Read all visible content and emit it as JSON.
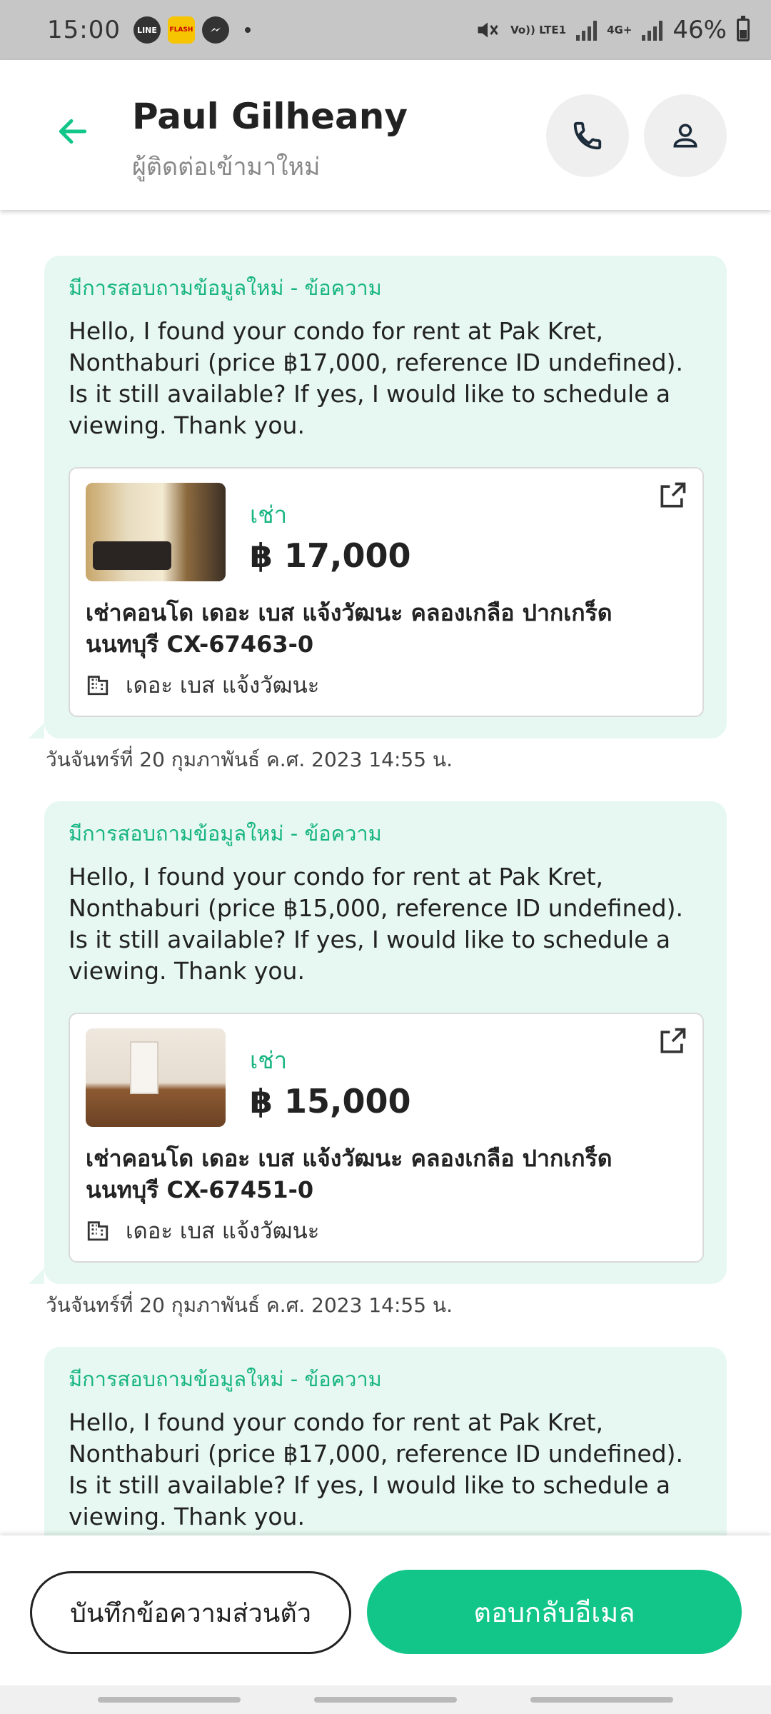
{
  "status_bar": {
    "time": "15:00",
    "notifications": [
      "LINE",
      "FLASH",
      "messenger"
    ],
    "network_1": "Vo)) LTE1",
    "network_2": "4G+",
    "battery": "46%"
  },
  "header": {
    "name": "Paul Gilheany",
    "subtitle": "ผู้ติดต่อเข้ามาใหม่"
  },
  "messages": [
    {
      "title": "มีการสอบถามข้อมูลใหม่ - ข้อความ",
      "text": "Hello, I found your condo for rent at Pak Kret, Nonthaburi (price ฿17,000, reference ID undefined). Is it still available? If yes, I would like to schedule a viewing. Thank you.",
      "listing": {
        "type": "เช่า",
        "price": "฿ 17,000",
        "title": "เช่าคอนโด  เดอะ เบส แจ้งวัฒนะ คลองเกลือ ปากเกร็ด นนทบุรี CX-67463-0",
        "project": "เดอะ เบส แจ้งวัฒนะ"
      },
      "timestamp": "วันจันทร์ที่ 20 กุมภาพันธ์ ค.ศ. 2023 14:55 น."
    },
    {
      "title": "มีการสอบถามข้อมูลใหม่ - ข้อความ",
      "text": "Hello, I found your condo for rent at Pak Kret, Nonthaburi (price ฿15,000, reference ID undefined). Is it still available? If yes, I would like to schedule a viewing. Thank you.",
      "listing": {
        "type": "เช่า",
        "price": "฿ 15,000",
        "title": "เช่าคอนโด  เดอะ เบส แจ้งวัฒนะ คลองเกลือ ปากเกร็ด นนทบุรี CX-67451-0",
        "project": "เดอะ เบส แจ้งวัฒนะ"
      },
      "timestamp": "วันจันทร์ที่ 20 กุมภาพันธ์ ค.ศ. 2023 14:55 น."
    },
    {
      "title": "มีการสอบถามข้อมูลใหม่ - ข้อความ",
      "text": "Hello, I found your condo for rent at Pak Kret, Nonthaburi (price ฿17,000, reference ID undefined). Is it still available? If yes, I would like to schedule a viewing. Thank you."
    }
  ],
  "actions": {
    "note_label": "บันทึกข้อความส่วนตัว",
    "reply_label": "ตอบกลับอีเมล"
  },
  "colors": {
    "accent": "#12c68a",
    "bubble_bg": "#e6f8f1",
    "status_bar_bg": "#c6c6c6"
  },
  "icons": [
    "back-arrow-icon",
    "phone-icon",
    "person-icon",
    "external-link-icon",
    "building-icon"
  ]
}
